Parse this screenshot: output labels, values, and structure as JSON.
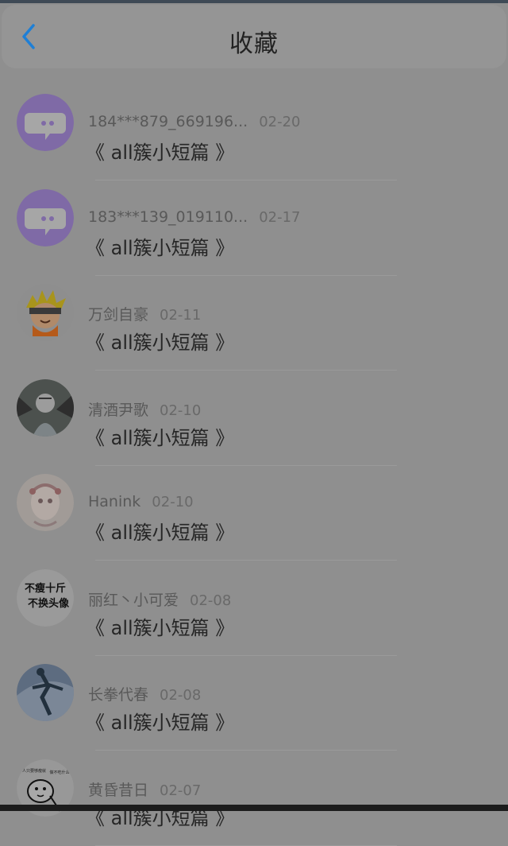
{
  "header": {
    "title": "收藏",
    "back_icon": "chevron-left-icon",
    "accent_color": "#1e7fd6"
  },
  "items": [
    {
      "user": "184***879_669196...",
      "date": "02-20",
      "title": "《 all簇小短篇 》",
      "avatar": "chat-bubble-avatar"
    },
    {
      "user": "183***139_019110...",
      "date": "02-17",
      "title": "《 all簇小短篇 》",
      "avatar": "chat-bubble-avatar"
    },
    {
      "user": "万剑自豪",
      "date": "02-11",
      "title": "《 all簇小短篇 》",
      "avatar": "anime-ninja-avatar"
    },
    {
      "user": "清酒尹歌",
      "date": "02-10",
      "title": "《 all簇小短篇 》",
      "avatar": "anime-dark-avatar"
    },
    {
      "user": "Hanink",
      "date": "02-10",
      "title": "《 all簇小短篇 》",
      "avatar": "anime-girl-avatar"
    },
    {
      "user": "丽红丶小可爱",
      "date": "02-08",
      "title": "《 all簇小短篇 》",
      "avatar": "text-avatar",
      "avatar_text": [
        "不瘦十斤",
        "不换头像"
      ]
    },
    {
      "user": "长拳代春",
      "date": "02-08",
      "title": "《 all簇小短篇 》",
      "avatar": "figure-blue-avatar"
    },
    {
      "user": "黄昏昔日",
      "date": "02-07",
      "title": "《 all簇小短篇 》",
      "avatar": "doodle-avatar",
      "avatar_text": [
        "人只要够瘦就",
        "做不吃什么"
      ]
    }
  ]
}
